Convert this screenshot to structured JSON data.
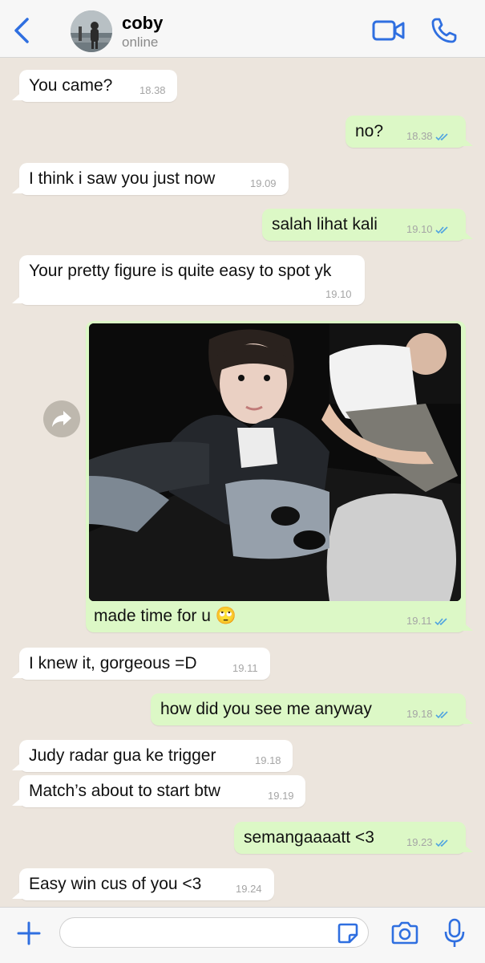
{
  "header": {
    "contact_name": "coby",
    "status": "online"
  },
  "icons": {
    "back": "chevron-left-icon",
    "video": "video-camera-icon",
    "call": "phone-icon",
    "forward": "forward-arrow-icon",
    "read_receipt": "double-check-icon",
    "plus": "plus-icon",
    "sticker": "sticker-icon",
    "camera": "camera-icon",
    "mic": "microphone-icon"
  },
  "colors": {
    "accent": "#2F6FE0",
    "incoming_bubble": "#FFFFFF",
    "outgoing_bubble": "#DCF8C6",
    "chat_background": "#ECE5DD",
    "read_tick": "#4FA3E0"
  },
  "messages": [
    {
      "direction": "in",
      "text": "You came?",
      "time": "18.38"
    },
    {
      "direction": "out",
      "text": "no?",
      "time": "18.38",
      "read": true
    },
    {
      "direction": "in",
      "text": "I think i saw you just now",
      "time": "19.09"
    },
    {
      "direction": "out",
      "text": "salah lihat kali",
      "time": "19.10",
      "read": true
    },
    {
      "direction": "in",
      "text": "Your pretty figure is quite easy to spot yk",
      "time": "19.10"
    },
    {
      "direction": "out",
      "type": "photo",
      "caption": "made time for u 🙄",
      "time": "19.11",
      "read": true
    },
    {
      "direction": "in",
      "text": "I knew it, gorgeous =D",
      "time": "19.11"
    },
    {
      "direction": "out",
      "text": "how did you see me anyway",
      "time": "19.18",
      "read": true
    },
    {
      "direction": "in",
      "text": "Judy radar gua ke trigger",
      "time": "19.18"
    },
    {
      "direction": "in",
      "text": "Match’s about to start btw",
      "time": "19.19"
    },
    {
      "direction": "out",
      "text": "semangaaaatt <3",
      "time": "19.23",
      "read": true
    },
    {
      "direction": "in",
      "text": "Easy win cus of you <3",
      "time": "19.24"
    }
  ],
  "composer": {
    "value": "",
    "placeholder": ""
  }
}
